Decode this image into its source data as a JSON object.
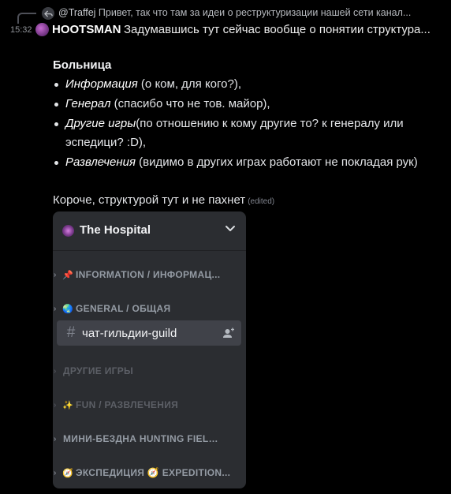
{
  "reply": {
    "author": "@Traffej",
    "text": "Привет, так что там за идеи о реструктуризации нашей сети канал..."
  },
  "message": {
    "timestamp": "15:32",
    "author": "HOOTSMAN",
    "text": "Задумавшись тут сейчас вообще о понятии структура...",
    "heading": "Больница",
    "bullets": [
      {
        "em": "Информация",
        "rest": "  (о ком, для кого?),"
      },
      {
        "em": "Генерал",
        "rest": "  (спасибо что не тов. майор),"
      },
      {
        "em": "Другие игры",
        "rest": "(по отношению к кому другие то? к генералу или эспедици? :D),"
      },
      {
        "em": "Развлечения",
        "rest": " (видимо в других играх работают не покладая рук)"
      }
    ],
    "summary": "Короче, структурой тут и не пахнет",
    "edited": "(edited)"
  },
  "embed": {
    "server_name": "The Hospital",
    "categories": [
      {
        "emoji": "📌",
        "label": "INFORMATION / ИНФОРМАЦ...",
        "dim": false
      },
      {
        "emoji": "🌏",
        "label": "GENERAL / ОБЩАЯ",
        "dim": false
      },
      {
        "emoji": "",
        "label": "ДРУГИЕ ИГРЫ",
        "dim": true
      },
      {
        "emoji": "✨",
        "label": "FUN / РАЗВЛЕЧЕНИЯ",
        "dim": true
      },
      {
        "emoji": "",
        "label": "МИНИ-БЕЗДНА HUNTING FIELDS",
        "dim": false
      },
      {
        "emoji": "🧭",
        "label": "ЭКСПЕДИЦИЯ 🧭 EXPEDITION...",
        "dim": false
      }
    ],
    "channel": {
      "name": "чат-гильдии-guild"
    }
  },
  "colors": {
    "background": "#000000",
    "sidebar": "#2b2d31",
    "selected_channel": "#404249",
    "muted_text": "#949ba4"
  }
}
